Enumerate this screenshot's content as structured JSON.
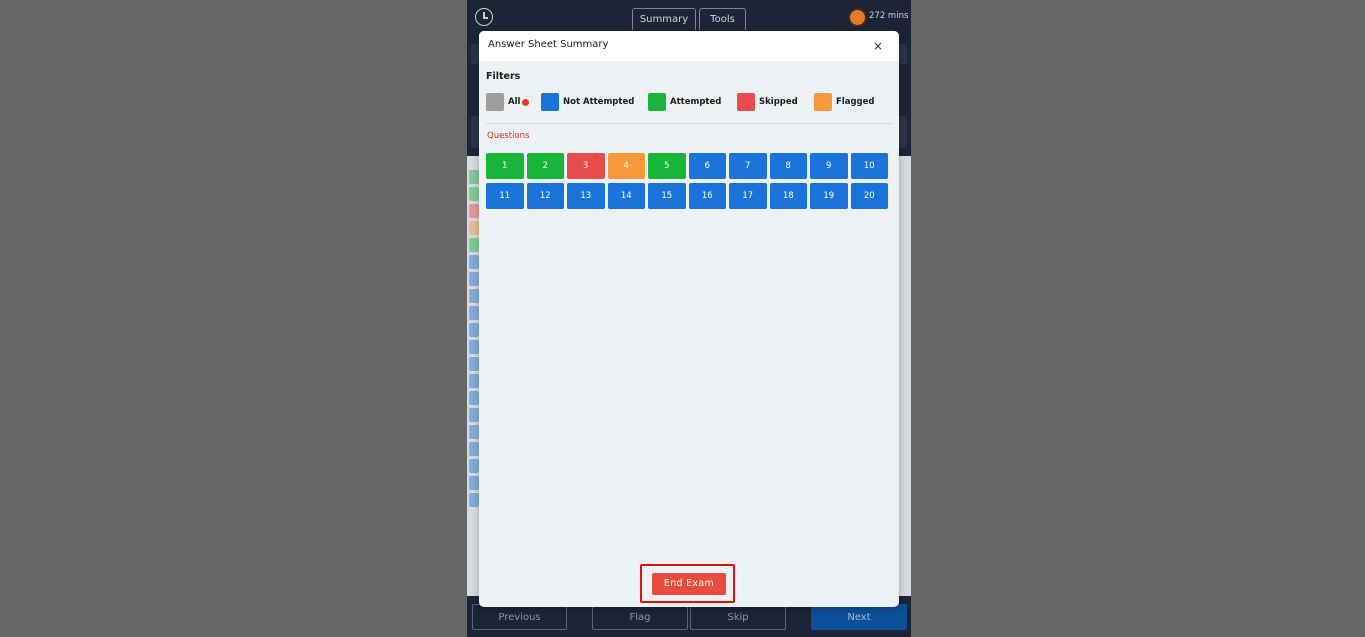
{
  "app": {
    "tabs": [
      {
        "label": "Summary"
      },
      {
        "label": "Tools"
      }
    ],
    "timer": "272 mins",
    "bottom_bar": {
      "previous": "Previous",
      "flag": "Flag",
      "skip": "Skip",
      "next": "Next"
    }
  },
  "modal": {
    "title": "Answer Sheet Summary",
    "close_glyph": "×",
    "filters_label": "Filters",
    "filters": [
      {
        "label": "All",
        "color": "#9e9e9e",
        "active": true
      },
      {
        "label": "Not Attempted",
        "color": "#1a73d9"
      },
      {
        "label": "Attempted",
        "color": "#18b53a"
      },
      {
        "label": "Skipped",
        "color": "#e84c4c"
      },
      {
        "label": "Flagged",
        "color": "#f6993a"
      }
    ],
    "questions_label": "Questions",
    "questions": [
      {
        "number": "1",
        "status": "attempted"
      },
      {
        "number": "2",
        "status": "attempted"
      },
      {
        "number": "3",
        "status": "skipped"
      },
      {
        "number": "4",
        "status": "flagged"
      },
      {
        "number": "5",
        "status": "attempted"
      },
      {
        "number": "6",
        "status": "not_attempted"
      },
      {
        "number": "7",
        "status": "not_attempted"
      },
      {
        "number": "8",
        "status": "not_attempted"
      },
      {
        "number": "9",
        "status": "not_attempted"
      },
      {
        "number": "10",
        "status": "not_attempted"
      },
      {
        "number": "11",
        "status": "not_attempted"
      },
      {
        "number": "12",
        "status": "not_attempted"
      },
      {
        "number": "13",
        "status": "not_attempted"
      },
      {
        "number": "14",
        "status": "not_attempted"
      },
      {
        "number": "15",
        "status": "not_attempted"
      },
      {
        "number": "16",
        "status": "not_attempted"
      },
      {
        "number": "17",
        "status": "not_attempted"
      },
      {
        "number": "18",
        "status": "not_attempted"
      },
      {
        "number": "19",
        "status": "not_attempted"
      },
      {
        "number": "20",
        "status": "not_attempted"
      }
    ],
    "status_colors": {
      "attempted": "#18b53a",
      "skipped": "#e84c4c",
      "flagged": "#f6993a",
      "not_attempted": "#1a73d9"
    },
    "end_exam_label": "End Exam"
  }
}
